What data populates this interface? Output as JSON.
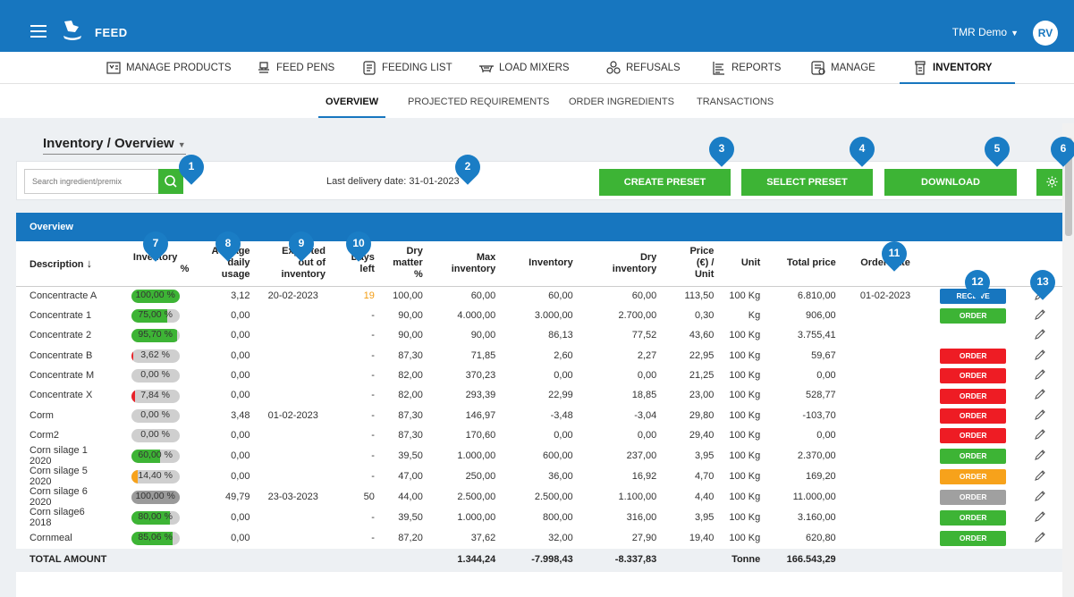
{
  "app": {
    "title": "FEED",
    "account": "TMR Demo",
    "avatar": "RV"
  },
  "nav": [
    {
      "label": "MANAGE PRODUCTS",
      "icon": "products-icon"
    },
    {
      "label": "FEED PENS",
      "icon": "feed-pens-icon"
    },
    {
      "label": "FEEDING LIST",
      "icon": "feeding-list-icon"
    },
    {
      "label": "LOAD MIXERS",
      "icon": "load-mixers-icon"
    },
    {
      "label": "REFUSALS",
      "icon": "refusals-icon"
    },
    {
      "label": "REPORTS",
      "icon": "reports-icon"
    },
    {
      "label": "MANAGE",
      "icon": "manage-icon"
    },
    {
      "label": "INVENTORY",
      "icon": "inventory-icon",
      "active": true
    }
  ],
  "subtabs": [
    "OVERVIEW",
    "PROJECTED REQUIREMENTS",
    "ORDER INGREDIENTS",
    "TRANSACTIONS"
  ],
  "page": {
    "title": "Inventory / Overview",
    "search_placeholder": "Search ingredient/premix",
    "last_delivery": "Last delivery date: 31-01-2023",
    "create_preset": "CREATE PRESET",
    "select_preset": "SELECT PRESET",
    "download": "DOWNLOAD"
  },
  "markers": [
    "1",
    "2",
    "3",
    "4",
    "5",
    "6",
    "7",
    "8",
    "9",
    "10",
    "11",
    "12",
    "13"
  ],
  "table": {
    "section_title": "Overview",
    "headers": {
      "description": "Description",
      "inventory_pct": [
        "Inventory",
        "%"
      ],
      "avg_usage": [
        "Average",
        "daily",
        "usage"
      ],
      "expected_out": [
        "Expected",
        "out of",
        "inventory"
      ],
      "days_left": [
        "Days",
        "left"
      ],
      "dry_matter": [
        "Dry",
        "matter",
        "%"
      ],
      "max_inventory": [
        "Max",
        "inventory"
      ],
      "inventory": "Inventory",
      "dry_inventory": [
        "Dry",
        "inventory"
      ],
      "price": [
        "Price",
        "(€) /",
        "Unit"
      ],
      "unit": "Unit",
      "total_price": "Total price",
      "order_date": "Order date"
    },
    "rows": [
      {
        "desc": "Concentracte A",
        "pct": "100,00 %",
        "pct_val": 100,
        "bar": "#3db435",
        "avg": "3,12",
        "exp": "20-02-2023",
        "days": "19",
        "days_orange": true,
        "dm": "100,00",
        "max": "60,00",
        "inv": "60,00",
        "dry": "60,00",
        "price": "113,50",
        "unit": "100 Kg",
        "total": "6.810,00",
        "order": "01-02-2023",
        "action": "RECEIVE",
        "action_color": "#1776bf"
      },
      {
        "desc": "Concentrate 1",
        "pct": "75,00 %",
        "pct_val": 75,
        "bar": "#3db435",
        "avg": "0,00",
        "exp": "",
        "days": "-",
        "dm": "90,00",
        "max": "4.000,00",
        "inv": "3.000,00",
        "dry": "2.700,00",
        "price": "0,30",
        "unit": "Kg",
        "total": "906,00",
        "order": "",
        "action": "ORDER",
        "action_color": "#3db435"
      },
      {
        "desc": "Concentrate 2",
        "pct": "95,70 %",
        "pct_val": 95.7,
        "bar": "#3db435",
        "avg": "0,00",
        "exp": "",
        "days": "-",
        "dm": "90,00",
        "max": "90,00",
        "inv": "86,13",
        "dry": "77,52",
        "price": "43,60",
        "unit": "100 Kg",
        "total": "3.755,41",
        "order": "",
        "action": "",
        "action_color": ""
      },
      {
        "desc": "Concentrate B",
        "pct": "3,62 %",
        "pct_val": 3.62,
        "bar": "#e8232a",
        "avg": "0,00",
        "exp": "",
        "days": "-",
        "dm": "87,30",
        "max": "71,85",
        "inv": "2,60",
        "dry": "2,27",
        "price": "22,95",
        "unit": "100 Kg",
        "total": "59,67",
        "order": "",
        "action": "ORDER",
        "action_color": "#ee1c24"
      },
      {
        "desc": "Concentrate M",
        "pct": "0,00 %",
        "pct_val": 0,
        "bar": "#cfcfcf",
        "avg": "0,00",
        "exp": "",
        "days": "-",
        "dm": "82,00",
        "max": "370,23",
        "inv": "0,00",
        "dry": "0,00",
        "price": "21,25",
        "unit": "100 Kg",
        "total": "0,00",
        "order": "",
        "action": "ORDER",
        "action_color": "#ee1c24"
      },
      {
        "desc": "Concentrate X",
        "pct": "7,84 %",
        "pct_val": 7.84,
        "bar": "#e8232a",
        "avg": "0,00",
        "exp": "",
        "days": "-",
        "dm": "82,00",
        "max": "293,39",
        "inv": "22,99",
        "dry": "18,85",
        "price": "23,00",
        "unit": "100 Kg",
        "total": "528,77",
        "order": "",
        "action": "ORDER",
        "action_color": "#ee1c24"
      },
      {
        "desc": "Corm",
        "pct": "0,00 %",
        "pct_val": 0,
        "bar": "#cfcfcf",
        "avg": "3,48",
        "exp": "01-02-2023",
        "days": "-",
        "dm": "87,30",
        "max": "146,97",
        "inv": "-3,48",
        "dry": "-3,04",
        "price": "29,80",
        "unit": "100 Kg",
        "total": "-103,70",
        "order": "",
        "action": "ORDER",
        "action_color": "#ee1c24"
      },
      {
        "desc": "Corm2",
        "pct": "0,00 %",
        "pct_val": 0,
        "bar": "#cfcfcf",
        "avg": "0,00",
        "exp": "",
        "days": "-",
        "dm": "87,30",
        "max": "170,60",
        "inv": "0,00",
        "dry": "0,00",
        "price": "29,40",
        "unit": "100 Kg",
        "total": "0,00",
        "order": "",
        "action": "ORDER",
        "action_color": "#ee1c24"
      },
      {
        "desc": "Corn silage 1",
        "desc2": "2020",
        "pct": "60,00 %",
        "pct_val": 60,
        "bar": "#3db435",
        "avg": "0,00",
        "exp": "",
        "days": "-",
        "dm": "39,50",
        "max": "1.000,00",
        "inv": "600,00",
        "dry": "237,00",
        "price": "3,95",
        "unit": "100 Kg",
        "total": "2.370,00",
        "order": "",
        "action": "ORDER",
        "action_color": "#3db435"
      },
      {
        "desc": "Corn silage 5",
        "desc2": "2020",
        "pct": "14,40 %",
        "pct_val": 14.4,
        "bar": "#f7a21b",
        "avg": "0,00",
        "exp": "",
        "days": "-",
        "dm": "47,00",
        "max": "250,00",
        "inv": "36,00",
        "dry": "16,92",
        "price": "4,70",
        "unit": "100 Kg",
        "total": "169,20",
        "order": "",
        "action": "ORDER",
        "action_color": "#f7a21b"
      },
      {
        "desc": "Corn silage 6",
        "desc2": "2020",
        "pct": "100,00 %",
        "pct_val": 100,
        "bar": "#9a9a9a",
        "avg": "49,79",
        "exp": "23-03-2023",
        "days": "50",
        "dm": "44,00",
        "max": "2.500,00",
        "inv": "2.500,00",
        "dry": "1.100,00",
        "price": "4,40",
        "unit": "100 Kg",
        "total": "11.000,00",
        "order": "",
        "action": "ORDER",
        "action_color": "#a0a0a0"
      },
      {
        "desc": "Corn silage6",
        "desc2": "2018",
        "pct": "80,00 %",
        "pct_val": 80,
        "bar": "#3db435",
        "avg": "0,00",
        "exp": "",
        "days": "-",
        "dm": "39,50",
        "max": "1.000,00",
        "inv": "800,00",
        "dry": "316,00",
        "price": "3,95",
        "unit": "100 Kg",
        "total": "3.160,00",
        "order": "",
        "action": "ORDER",
        "action_color": "#3db435"
      },
      {
        "desc": "Cornmeal",
        "pct": "85,06 %",
        "pct_val": 85.06,
        "bar": "#3db435",
        "avg": "0,00",
        "exp": "",
        "days": "-",
        "dm": "87,20",
        "max": "37,62",
        "inv": "32,00",
        "dry": "27,90",
        "price": "19,40",
        "unit": "100 Kg",
        "total": "620,80",
        "order": "",
        "action": "ORDER",
        "action_color": "#3db435"
      }
    ],
    "total": {
      "label": "TOTAL AMOUNT",
      "max": "1.344,24",
      "inv": "-7.998,43",
      "dry": "-8.337,83",
      "unit": "Tonne",
      "total": "166.543,29"
    }
  }
}
